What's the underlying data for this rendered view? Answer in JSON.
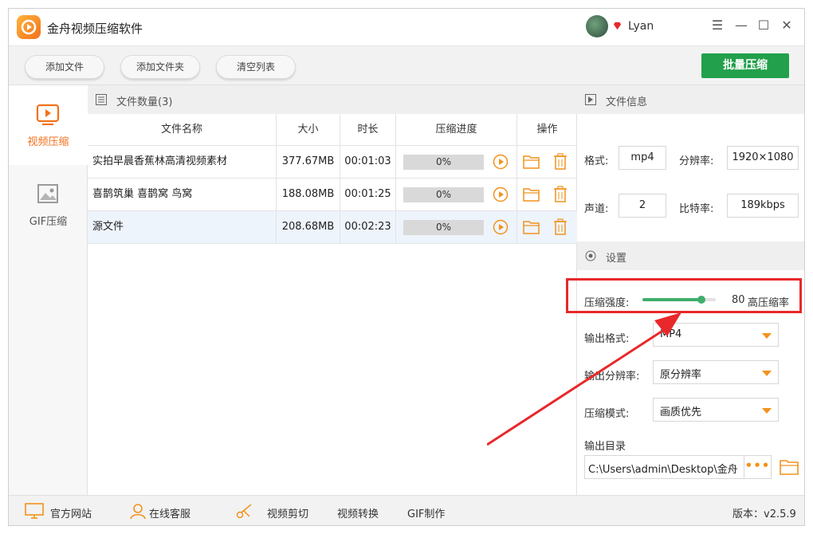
{
  "app": {
    "title": "金舟视频压缩软件",
    "user": "Lyan"
  },
  "window_controls": {
    "menu": "☰",
    "minimize": "—",
    "maximize": "☐",
    "close": "✕"
  },
  "toolbar": {
    "add_file": "添加文件",
    "add_folder": "添加文件夹",
    "clear_list": "清空列表",
    "batch_compress": "批量压缩"
  },
  "sidebar": {
    "items": [
      {
        "label": "视频压缩",
        "active": true
      },
      {
        "label": "GIF压缩",
        "active": false
      }
    ]
  },
  "file_list": {
    "header": "文件数量(3)",
    "columns": [
      "文件名称",
      "大小",
      "时长",
      "压缩进度",
      "操作"
    ],
    "rows": [
      {
        "name": "实拍早晨香蕉林高清视频素材",
        "size": "377.67MB",
        "duration": "00:01:03",
        "progress": "0%"
      },
      {
        "name": "喜鹊筑巢 喜鹊窝 鸟窝",
        "size": "188.08MB",
        "duration": "00:01:25",
        "progress": "0%"
      },
      {
        "name": "源文件",
        "size": "208.68MB",
        "duration": "00:02:23",
        "progress": "0%"
      }
    ]
  },
  "file_info": {
    "header": "文件信息",
    "format_label": "格式:",
    "format": "mp4",
    "resolution_label": "分辨率:",
    "resolution": "1920×1080",
    "channel_label": "声道:",
    "channel": "2",
    "bitrate_label": "比特率:",
    "bitrate": "189kbps"
  },
  "settings": {
    "header": "设置",
    "strength_label": "压缩强度:",
    "strength_value": "80",
    "strength_text": "高压缩率",
    "strength_fraction": 0.8,
    "output_format_label": "输出格式:",
    "output_format": "MP4",
    "output_resolution_label": "输出分辨率:",
    "output_resolution": "原分辨率",
    "mode_label": "压缩模式:",
    "mode": "画质优先",
    "output_dir_label": "输出目录",
    "output_dir": "C:\\Users\\admin\\Desktop\\金舟",
    "more": "•••"
  },
  "footer": {
    "website": "官方网站",
    "support": "在线客服",
    "video_edit": "视频剪切",
    "video_convert": "视频转换",
    "gif_make": "GIF制作",
    "version": "版本：v2.5.9"
  },
  "colors": {
    "accent": "#22a04b",
    "orange": "#f2921c",
    "highlight": "#e8282b"
  }
}
